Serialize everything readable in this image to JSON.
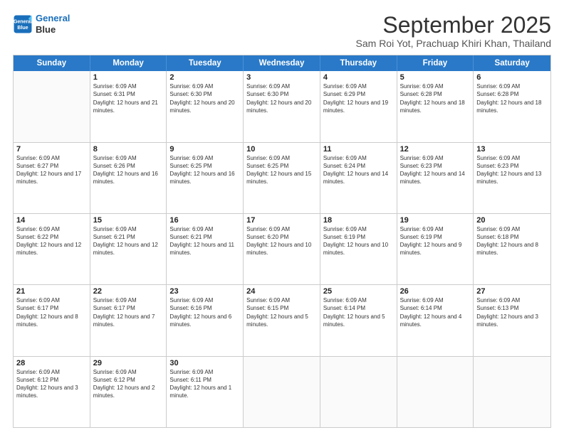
{
  "logo": {
    "line1": "General",
    "line2": "Blue"
  },
  "title": "September 2025",
  "subtitle": "Sam Roi Yot, Prachuap Khiri Khan, Thailand",
  "header_days": [
    "Sunday",
    "Monday",
    "Tuesday",
    "Wednesday",
    "Thursday",
    "Friday",
    "Saturday"
  ],
  "rows": [
    [
      {
        "day": "",
        "empty": true
      },
      {
        "day": "1",
        "rise": "6:09 AM",
        "set": "6:31 PM",
        "daylight": "12 hours and 21 minutes."
      },
      {
        "day": "2",
        "rise": "6:09 AM",
        "set": "6:30 PM",
        "daylight": "12 hours and 20 minutes."
      },
      {
        "day": "3",
        "rise": "6:09 AM",
        "set": "6:30 PM",
        "daylight": "12 hours and 20 minutes."
      },
      {
        "day": "4",
        "rise": "6:09 AM",
        "set": "6:29 PM",
        "daylight": "12 hours and 19 minutes."
      },
      {
        "day": "5",
        "rise": "6:09 AM",
        "set": "6:28 PM",
        "daylight": "12 hours and 18 minutes."
      },
      {
        "day": "6",
        "rise": "6:09 AM",
        "set": "6:28 PM",
        "daylight": "12 hours and 18 minutes."
      }
    ],
    [
      {
        "day": "7",
        "rise": "6:09 AM",
        "set": "6:27 PM",
        "daylight": "12 hours and 17 minutes."
      },
      {
        "day": "8",
        "rise": "6:09 AM",
        "set": "6:26 PM",
        "daylight": "12 hours and 16 minutes."
      },
      {
        "day": "9",
        "rise": "6:09 AM",
        "set": "6:25 PM",
        "daylight": "12 hours and 16 minutes."
      },
      {
        "day": "10",
        "rise": "6:09 AM",
        "set": "6:25 PM",
        "daylight": "12 hours and 15 minutes."
      },
      {
        "day": "11",
        "rise": "6:09 AM",
        "set": "6:24 PM",
        "daylight": "12 hours and 14 minutes."
      },
      {
        "day": "12",
        "rise": "6:09 AM",
        "set": "6:23 PM",
        "daylight": "12 hours and 14 minutes."
      },
      {
        "day": "13",
        "rise": "6:09 AM",
        "set": "6:23 PM",
        "daylight": "12 hours and 13 minutes."
      }
    ],
    [
      {
        "day": "14",
        "rise": "6:09 AM",
        "set": "6:22 PM",
        "daylight": "12 hours and 12 minutes."
      },
      {
        "day": "15",
        "rise": "6:09 AM",
        "set": "6:21 PM",
        "daylight": "12 hours and 12 minutes."
      },
      {
        "day": "16",
        "rise": "6:09 AM",
        "set": "6:21 PM",
        "daylight": "12 hours and 11 minutes."
      },
      {
        "day": "17",
        "rise": "6:09 AM",
        "set": "6:20 PM",
        "daylight": "12 hours and 10 minutes."
      },
      {
        "day": "18",
        "rise": "6:09 AM",
        "set": "6:19 PM",
        "daylight": "12 hours and 10 minutes."
      },
      {
        "day": "19",
        "rise": "6:09 AM",
        "set": "6:19 PM",
        "daylight": "12 hours and 9 minutes."
      },
      {
        "day": "20",
        "rise": "6:09 AM",
        "set": "6:18 PM",
        "daylight": "12 hours and 8 minutes."
      }
    ],
    [
      {
        "day": "21",
        "rise": "6:09 AM",
        "set": "6:17 PM",
        "daylight": "12 hours and 8 minutes."
      },
      {
        "day": "22",
        "rise": "6:09 AM",
        "set": "6:17 PM",
        "daylight": "12 hours and 7 minutes."
      },
      {
        "day": "23",
        "rise": "6:09 AM",
        "set": "6:16 PM",
        "daylight": "12 hours and 6 minutes."
      },
      {
        "day": "24",
        "rise": "6:09 AM",
        "set": "6:15 PM",
        "daylight": "12 hours and 5 minutes."
      },
      {
        "day": "25",
        "rise": "6:09 AM",
        "set": "6:14 PM",
        "daylight": "12 hours and 5 minutes."
      },
      {
        "day": "26",
        "rise": "6:09 AM",
        "set": "6:14 PM",
        "daylight": "12 hours and 4 minutes."
      },
      {
        "day": "27",
        "rise": "6:09 AM",
        "set": "6:13 PM",
        "daylight": "12 hours and 3 minutes."
      }
    ],
    [
      {
        "day": "28",
        "rise": "6:09 AM",
        "set": "6:12 PM",
        "daylight": "12 hours and 3 minutes."
      },
      {
        "day": "29",
        "rise": "6:09 AM",
        "set": "6:12 PM",
        "daylight": "12 hours and 2 minutes."
      },
      {
        "day": "30",
        "rise": "6:09 AM",
        "set": "6:11 PM",
        "daylight": "12 hours and 1 minute."
      },
      {
        "day": "",
        "empty": true
      },
      {
        "day": "",
        "empty": true
      },
      {
        "day": "",
        "empty": true
      },
      {
        "day": "",
        "empty": true
      }
    ]
  ]
}
